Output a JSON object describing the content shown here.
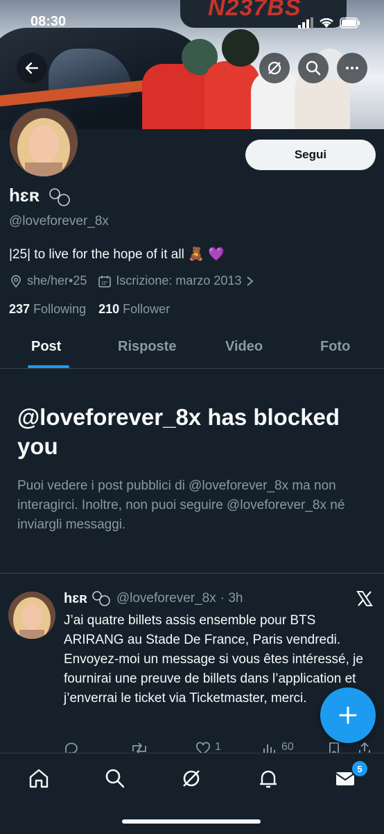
{
  "status_bar": {
    "time": "08:30"
  },
  "banner": {
    "registration": "N237BS"
  },
  "profile": {
    "follow_label": "Segui",
    "display_name": "hɛʀ",
    "handle": "@loveforever_8x",
    "bio": "|25| to live for the hope of it all 🧸 💜",
    "pronouns": "she/her•25",
    "joined": "Iscrizione: marzo 2013",
    "following_count": "237",
    "following_label": "Following",
    "followers_count": "210",
    "followers_label": "Follower"
  },
  "tabs": [
    {
      "label": "Post",
      "active": true
    },
    {
      "label": "Risposte",
      "active": false
    },
    {
      "label": "Video",
      "active": false
    },
    {
      "label": "Foto",
      "active": false
    }
  ],
  "blocked": {
    "title": "@loveforever_8x has blocked you",
    "body": "Puoi vedere i post pubblici di @loveforever_8x ma non interagirci. Inoltre, non puoi seguire @loveforever_8x né inviargli messaggi."
  },
  "post": {
    "name": "hɛʀ",
    "handle": "@loveforever_8x",
    "time": "· 3h",
    "text": "J’ai quatre billets assis ensemble pour BTS ARIRANG au Stade De France, Paris vendredi. Envoyez-moi un message si vous êtes intéressé, je fournirai une preuve de billets dans l’application et j’enverrai le ticket via Ticketmaster, merci.",
    "likes": "1",
    "views": "60"
  },
  "nav": {
    "messages_badge": "5"
  },
  "colors": {
    "accent": "#1d9bf0",
    "background": "#15202b",
    "muted": "#8b98a5"
  },
  "icons": [
    "back-arrow-icon",
    "grok-icon",
    "search-icon",
    "more-icon",
    "location-icon",
    "calendar-icon",
    "x-logo-icon",
    "plus-icon",
    "home-icon",
    "messages-icon",
    "notifications-icon"
  ]
}
